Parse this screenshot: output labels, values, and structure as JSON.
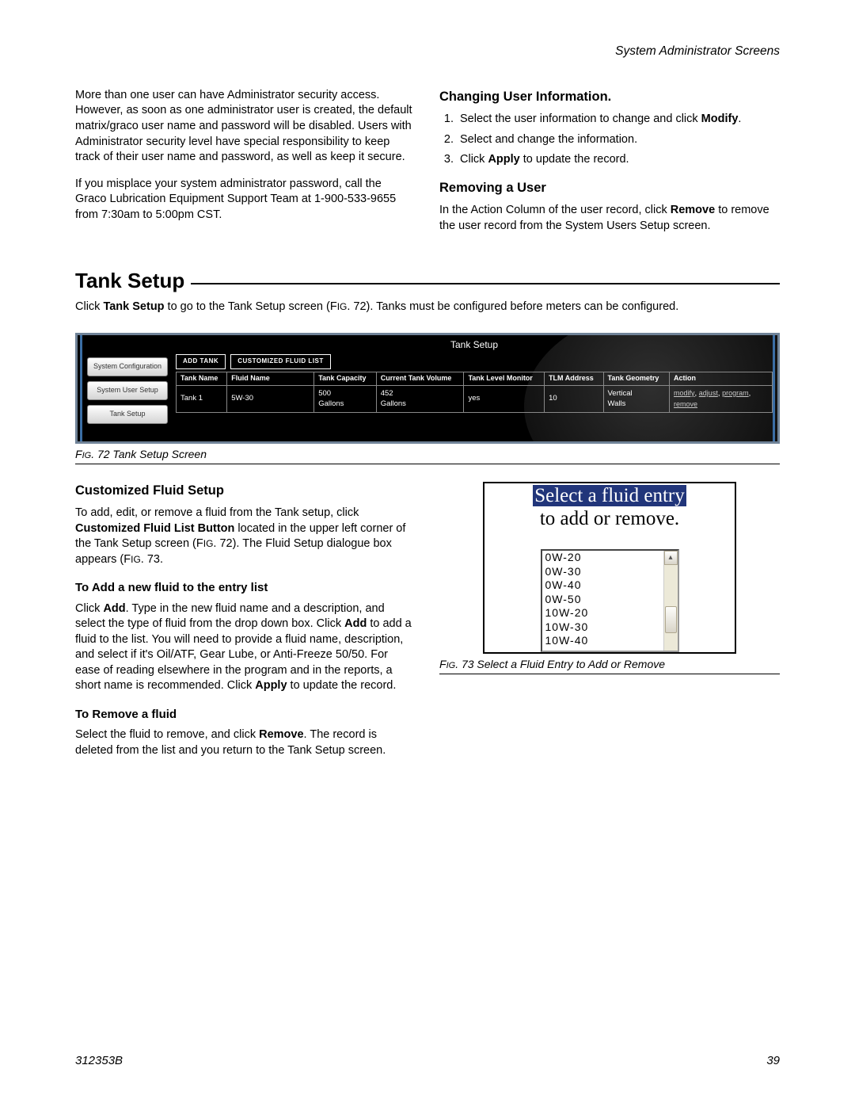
{
  "header": {
    "section": "System Administrator Screens"
  },
  "intro": {
    "p1": "More than one user can have Administrator security access. However, as soon as one administrator user is created, the default matrix/graco user name and password will be disabled. Users with Administrator security level have special responsibility to keep track of their user name and password, as well as keep it secure.",
    "p2": "If you misplace your system administrator password, call the Graco Lubrication Equipment Support Team at 1-900-533-9655 from 7:30am to 5:00pm CST."
  },
  "changing": {
    "title": "Changing User Information.",
    "s1a": "Select the user information to change and click ",
    "s1b": "Modify",
    "s1c": ".",
    "s2": "Select and change the information.",
    "s3a": "Click ",
    "s3b": "Apply",
    "s3c": " to update the record."
  },
  "removing": {
    "title": "Removing a User",
    "p1a": "In the Action Column of the user record, click ",
    "p1b": "Remove",
    "p1c": " to remove the user record from the System Users Setup screen."
  },
  "tanksetup": {
    "title": "Tank Setup",
    "p1a": "Click ",
    "p1b": "Tank Setup",
    "p1c": " to go to the Tank Setup screen (F",
    "p1d": "IG",
    "p1e": ". 72). Tanks must be configured before meters can be configured."
  },
  "fig72": {
    "title": "Tank Setup",
    "nav": {
      "a": "System Configuration",
      "b": "System User Setup",
      "c": "Tank Setup"
    },
    "btns": {
      "add": "ADD TANK",
      "cust": "CUSTOMIZED FLUID LIST"
    },
    "th": {
      "c1": "Tank Name",
      "c2": "Fluid Name",
      "c3": "Tank Capacity",
      "c4": "Current Tank Volume",
      "c5": "Tank Level Monitor",
      "c6": "TLM Address",
      "c7": "Tank Geometry",
      "c8": "Action"
    },
    "row": {
      "c1": "Tank 1",
      "c2": "5W-30",
      "c3a": "500",
      "c3b": "Gallons",
      "c4a": "452",
      "c4b": "Gallons",
      "c5": "yes",
      "c6": "10",
      "c7a": "Vertical",
      "c7b": "Walls",
      "a1": "modify",
      "a2": "adjust",
      "a3": "program",
      "a4": "remove"
    },
    "caption_a": "F",
    "caption_b": "IG",
    "caption_c": ". 72 Tank Setup Screen"
  },
  "custom": {
    "title": "Customized Fluid Setup",
    "p1a": "To add, edit, or remove a fluid from the Tank setup, click ",
    "p1b": "Customized Fluid List Button",
    "p1c": " located in the upper left corner of the Tank Setup screen (F",
    "p1d": "IG",
    "p1e": ". 72). The Fluid Setup dialogue box appears (F",
    "p1f": "IG",
    "p1g": ". 73.",
    "addTitle": "To Add a new fluid to the entry list",
    "addP_a": "Click ",
    "addP_b": "Add",
    "addP_c": ". Type in the new fluid name and a description, and select the type of fluid from the drop down box. Click ",
    "addP_d": "Add",
    "addP_e": " to add a fluid to the list. You will need to provide a fluid name, description, and select if it's Oil/ATF, Gear Lube, or Anti-Freeze 50/50. For ease of reading elsewhere in the program and in the reports, a short name is recommended. Click ",
    "addP_f": "Apply",
    "addP_g": " to update the record.",
    "remTitle": "To Remove a fluid",
    "remP_a": "Select the fluid to remove, and click ",
    "remP_b": "Remove",
    "remP_c": ". The record is deleted from the list and you return to the Tank Setup screen."
  },
  "fig73": {
    "title_l1": "Select a fluid entry",
    "title_l2": "to add or remove.",
    "items": {
      "i0": "0W-20",
      "i1": "0W-30",
      "i2": "0W-40",
      "i3": "0W-50",
      "i4": "10W-20",
      "i5": "10W-30",
      "i6": "10W-40"
    },
    "caption_a": "F",
    "caption_b": "IG",
    "caption_c": ". 73 Select a Fluid Entry to Add or Remove"
  },
  "footer": {
    "doc": "312353B",
    "page": "39"
  }
}
